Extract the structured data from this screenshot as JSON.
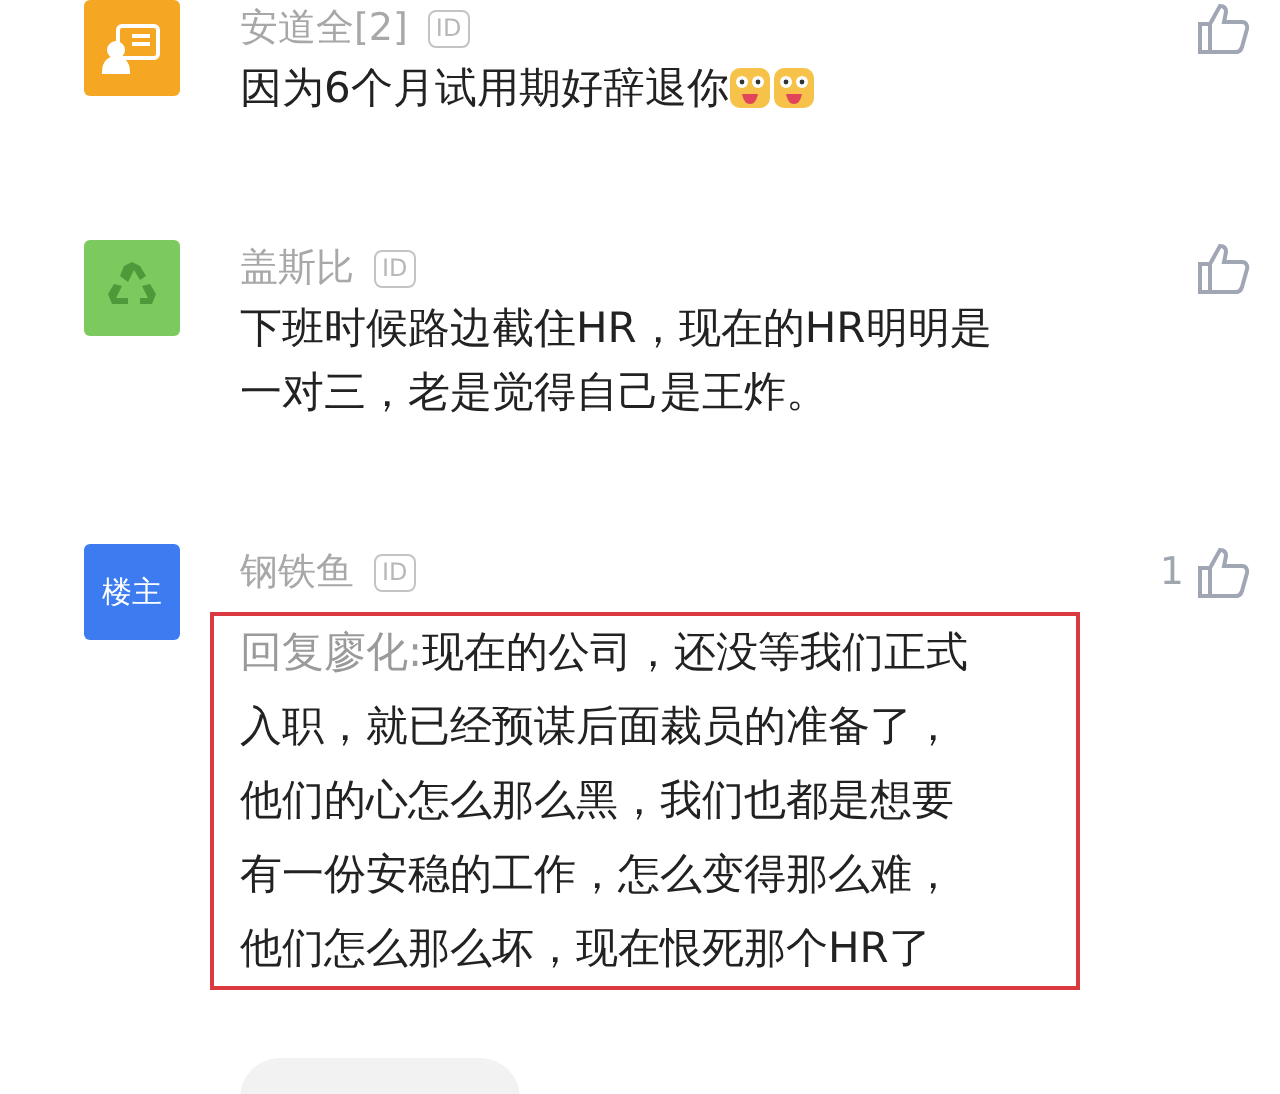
{
  "comments": [
    {
      "avatar": {
        "kind": "card",
        "color": "#f5a623"
      },
      "name": "安道全[2]",
      "badge": "ID",
      "lines": [
        "因为6个月试用期好辞退你"
      ],
      "emojis": [
        {
          "kind": "face"
        },
        {
          "kind": "face"
        }
      ]
    },
    {
      "avatar": {
        "kind": "recycle",
        "color": "#7cc95e"
      },
      "name": "盖斯比",
      "badge": "ID",
      "lines": [
        "下班时候路边截住HR，现在的HR明明是",
        "一对三，老是觉得自己是王炸。"
      ]
    },
    {
      "avatar": {
        "kind": "label",
        "color": "#3d7cf0",
        "label": "楼主"
      },
      "name": "钢铁鱼",
      "badge": "ID",
      "likes": "1",
      "highlighted": true,
      "reply_to": "回复廖化:",
      "lines": [
        "现在的公司，还没等我们正式",
        "入职，就已经预谋后面裁员的准备了，",
        "他们的心怎么那么黑，我们也都是想要",
        "有一份安稳的工作，怎么变得那么难，",
        "他们怎么那么坏，现在恨死那个HR了"
      ]
    }
  ]
}
